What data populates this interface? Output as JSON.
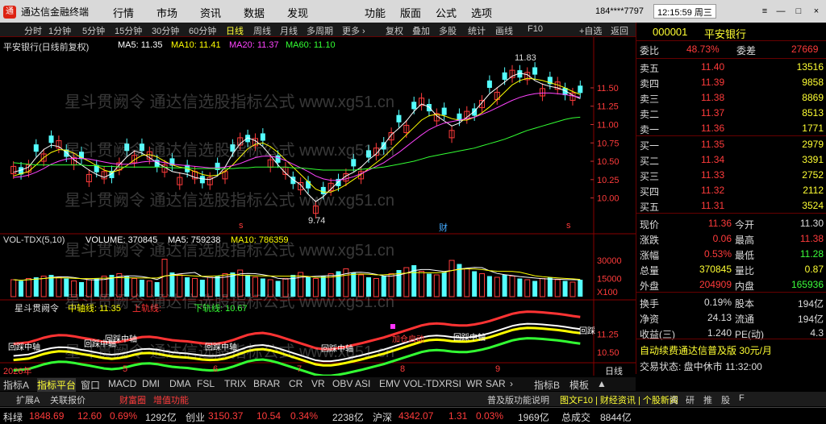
{
  "titlebar": {
    "app_name": "通达信金融终端",
    "menus": [
      "行情",
      "市场",
      "资讯",
      "数据",
      "发现",
      "功能",
      "版面",
      "公式",
      "选项"
    ],
    "account": "184****7797",
    "clock": "12:15:59 周三",
    "controls": [
      "≡",
      "—",
      "□",
      "×"
    ]
  },
  "toolbar": {
    "items": [
      "分时",
      "1分钟",
      "5分钟",
      "15分钟",
      "30分钟",
      "60分钟",
      "日线",
      "周线",
      "月线",
      "多周期",
      "更多 ›",
      "复权",
      "叠加",
      "多股",
      "统计",
      "画线",
      "F10",
      "+自选",
      "返回"
    ],
    "active": "日线"
  },
  "chart": {
    "main_label": "平安银行(日线前复权)",
    "ma_labels": [
      {
        "text": "MA5: 11.35",
        "color": "#ffffff"
      },
      {
        "text": "MA10: 11.41",
        "color": "#ffff00"
      },
      {
        "text": "MA20: 11.37",
        "color": "#ff44ff"
      },
      {
        "text": "MA60: 11.10",
        "color": "#33ff33"
      }
    ],
    "vol_label": "VOL-TDX(5,10)",
    "vol_values": [
      {
        "text": "VOLUME: 370845",
        "color": "#ffffff"
      },
      {
        "text": "MA5: 759238",
        "color": "#ffffff"
      },
      {
        "text": "MA10: 786359",
        "color": "#ffff00"
      }
    ],
    "ind_label": "星斗贯阙令",
    "ind_values": [
      {
        "text": "中轴线: 11.35",
        "color": "#ffff00"
      },
      {
        "text": "上轨线:",
        "color": "#ff3333"
      },
      {
        "text": "下轨线: 10.67",
        "color": "#33ff33"
      }
    ],
    "high_marker": "11.83",
    "low_marker": "9.74",
    "markers": [
      "s",
      "财",
      "s"
    ],
    "ind_tags": [
      "回踩中轴",
      "回踩中轴",
      "回踩中轴",
      "回踩中轴",
      "回踩中轴",
      "回踩中轴",
      "回踩"
    ],
    "start_tag": "加仓启动",
    "date_ticks": [
      "2026年",
      "5",
      "6",
      "7",
      "8",
      "9"
    ],
    "period_label": "日线",
    "watermark": "星斗贯阙令  通达信选股指标公式  www.xg51.cn"
  },
  "chart_data": [
    {
      "type": "line",
      "title": "",
      "ylim": [
        9.6,
        11.95
      ],
      "y_ticks": [
        "11.50",
        "11.25",
        "11.00",
        "10.75",
        "10.50",
        "10.25",
        "10.00"
      ],
      "series": [
        {
          "name": "MA5",
          "color": "#ffffff",
          "values": [
            10.35,
            10.38,
            10.42,
            10.55,
            10.66,
            10.72,
            10.7,
            10.62,
            10.52,
            10.45,
            10.38,
            10.32,
            10.28,
            10.33,
            10.45,
            10.56,
            10.64,
            10.61,
            10.55,
            10.48,
            10.42,
            10.36,
            10.34,
            10.32,
            10.28,
            10.26,
            10.25,
            10.3,
            10.42,
            10.6,
            10.74,
            10.82,
            10.78,
            10.7,
            10.58,
            10.45,
            10.34,
            10.25,
            10.18,
            10.05,
            9.95,
            10.02,
            10.12,
            10.22,
            10.3,
            10.35,
            10.42,
            10.52,
            10.6,
            10.72,
            10.86,
            10.95,
            11.05,
            11.18,
            11.28,
            11.24,
            11.12,
            11.05,
            10.98,
            11.02,
            11.1,
            11.18,
            11.3,
            11.42,
            11.5,
            11.58,
            11.66,
            11.7,
            11.68,
            11.6,
            11.55,
            11.52,
            11.5,
            11.46,
            11.4,
            11.35
          ]
        },
        {
          "name": "MA10",
          "color": "#ffff00",
          "values": [
            10.3,
            10.33,
            10.36,
            10.45,
            10.55,
            10.62,
            10.66,
            10.65,
            10.61,
            10.55,
            10.5,
            10.44,
            10.38,
            10.35,
            10.38,
            10.44,
            10.52,
            10.58,
            10.59,
            10.56,
            10.5,
            10.45,
            10.42,
            10.4,
            10.36,
            10.32,
            10.3,
            10.31,
            10.36,
            10.45,
            10.56,
            10.67,
            10.73,
            10.75,
            10.7,
            10.62,
            10.52,
            10.42,
            10.32,
            10.22,
            10.12,
            10.08,
            10.08,
            10.12,
            10.18,
            10.25,
            10.32,
            10.4,
            10.48,
            10.56,
            10.66,
            10.76,
            10.86,
            10.96,
            11.06,
            11.12,
            11.14,
            11.12,
            11.08,
            11.06,
            11.06,
            11.1,
            11.16,
            11.24,
            11.34,
            11.44,
            11.54,
            11.6,
            11.63,
            11.62,
            11.6,
            11.57,
            11.54,
            11.5,
            11.45,
            11.41
          ]
        },
        {
          "name": "MA20",
          "color": "#ff44ff",
          "values": [
            10.28,
            10.29,
            10.31,
            10.35,
            10.4,
            10.46,
            10.5,
            10.53,
            10.54,
            10.54,
            10.53,
            10.51,
            10.49,
            10.47,
            10.46,
            10.46,
            10.47,
            10.49,
            10.5,
            10.5,
            10.48,
            10.46,
            10.45,
            10.44,
            10.43,
            10.42,
            10.41,
            10.41,
            10.42,
            10.44,
            10.47,
            10.51,
            10.55,
            10.57,
            10.57,
            10.55,
            10.51,
            10.46,
            10.41,
            10.36,
            10.3,
            10.26,
            10.24,
            10.24,
            10.26,
            10.29,
            10.33,
            10.38,
            10.43,
            10.48,
            10.55,
            10.62,
            10.7,
            10.78,
            10.86,
            10.93,
            10.98,
            11.02,
            11.04,
            11.06,
            11.08,
            11.1,
            11.14,
            11.18,
            11.23,
            11.28,
            11.33,
            11.37,
            11.4,
            11.42,
            11.43,
            11.43,
            11.42,
            11.41,
            11.39,
            11.37
          ]
        },
        {
          "name": "MA60",
          "color": "#33ff33",
          "values": [
            10.48,
            10.47,
            10.46,
            10.45,
            10.45,
            10.45,
            10.45,
            10.45,
            10.45,
            10.45,
            10.44,
            10.44,
            10.43,
            10.43,
            10.42,
            10.42,
            10.42,
            10.42,
            10.42,
            10.42,
            10.42,
            10.41,
            10.41,
            10.41,
            10.4,
            10.4,
            10.4,
            10.4,
            10.4,
            10.4,
            10.41,
            10.41,
            10.42,
            10.42,
            10.42,
            10.42,
            10.42,
            10.41,
            10.41,
            10.4,
            10.39,
            10.38,
            10.38,
            10.38,
            10.38,
            10.38,
            10.39,
            10.4,
            10.41,
            10.42,
            10.44,
            10.46,
            10.48,
            10.5,
            10.53,
            10.56,
            10.58,
            10.6,
            10.62,
            10.64,
            10.66,
            10.68,
            10.71,
            10.74,
            10.77,
            10.8,
            10.84,
            10.88,
            10.92,
            10.95,
            10.98,
            11.01,
            11.04,
            11.07,
            11.09,
            11.1
          ]
        }
      ]
    },
    {
      "type": "bar",
      "title": "",
      "ylim": [
        0,
        40000
      ],
      "y_ticks": [
        "30000",
        "15000",
        "X100"
      ],
      "values": [
        14,
        13,
        15,
        16,
        17,
        18,
        16,
        15,
        13,
        12,
        14,
        15,
        17,
        18,
        19,
        17,
        15,
        14,
        13,
        12,
        31,
        20,
        18,
        16,
        15,
        14,
        16,
        17,
        19,
        20,
        22,
        18,
        16,
        15,
        14,
        13,
        15,
        18,
        20,
        16,
        15,
        17,
        19,
        21,
        23,
        20,
        18,
        16,
        15,
        17,
        19,
        22,
        24,
        26,
        21,
        19,
        18,
        20,
        30,
        27,
        23,
        21,
        19,
        17,
        16,
        18,
        17,
        15,
        14,
        13,
        15,
        16,
        14,
        13,
        12,
        14
      ]
    }
  ],
  "quote": {
    "code": "000001",
    "name": "平安银行",
    "weibi_label": "委比",
    "weibi_value": "48.73%",
    "weicha_label": "委差",
    "weicha_value": "27669",
    "asks": [
      {
        "label": "卖五",
        "price": "11.40",
        "vol": "13516"
      },
      {
        "label": "卖四",
        "price": "11.39",
        "vol": "9858"
      },
      {
        "label": "卖三",
        "price": "11.38",
        "vol": "8869"
      },
      {
        "label": "卖二",
        "price": "11.37",
        "vol": "8513"
      },
      {
        "label": "卖一",
        "price": "11.36",
        "vol": "1771"
      }
    ],
    "bids": [
      {
        "label": "买一",
        "price": "11.35",
        "vol": "2979"
      },
      {
        "label": "买二",
        "price": "11.34",
        "vol": "3391"
      },
      {
        "label": "买三",
        "price": "11.33",
        "vol": "2752"
      },
      {
        "label": "买四",
        "price": "11.32",
        "vol": "2112"
      },
      {
        "label": "买五",
        "price": "11.31",
        "vol": "3524"
      }
    ],
    "stats": [
      {
        "l1": "现价",
        "v1": "11.36",
        "c1": "red",
        "l2": "今开",
        "v2": "11.30",
        "c2": "wht"
      },
      {
        "l1": "涨跌",
        "v1": "0.06",
        "c1": "red",
        "l2": "最高",
        "v2": "11.38",
        "c2": "red"
      },
      {
        "l1": "涨幅",
        "v1": "0.53%",
        "c1": "red",
        "l2": "最低",
        "v2": "11.28",
        "c2": "grn"
      },
      {
        "l1": "总量",
        "v1": "370845",
        "c1": "yel",
        "l2": "量比",
        "v2": "0.87",
        "c2": "yel"
      },
      {
        "l1": "外盘",
        "v1": "204909",
        "c1": "red",
        "l2": "内盘",
        "v2": "165936",
        "c2": "grn"
      }
    ],
    "stats2": [
      {
        "l1": "换手",
        "v1": "0.19%",
        "l2": "股本",
        "v2": "194亿"
      },
      {
        "l1": "净资",
        "v1": "24.13",
        "l2": "流通",
        "v2": "194亿"
      },
      {
        "l1": "收益(三)",
        "v1": "1.240",
        "l2": "PE(动)",
        "v2": "4.3"
      }
    ],
    "promo": "自动续费通达信普及版 30元/月",
    "trade_state": "交易状态: 盘中休市 11:32:00"
  },
  "tabs1": {
    "items": [
      "指标A",
      "指标平台",
      "窗口",
      "MACD",
      "DMI",
      "DMA",
      "FSL",
      "TRIX",
      "BRAR",
      "CR",
      "VR",
      "OBV",
      "ASI",
      "EMV",
      "VOL-TDX",
      "RSI",
      "WR",
      "SAR",
      "›",
      "指标B",
      "模板",
      "▲"
    ],
    "active": "指标平台"
  },
  "tabs2": {
    "items": [
      "扩展A",
      "关联报价",
      "财富圈",
      "增值功能",
      "普及版功能说明",
      "图文F10 | 财经资讯 | 个股新闻",
      "资",
      "研",
      "推",
      "股",
      "F"
    ]
  },
  "status": {
    "items": [
      {
        "text": "科绿",
        "c": "wht"
      },
      {
        "text": "1848.69",
        "c": "red"
      },
      {
        "text": "12.60",
        "c": "red"
      },
      {
        "text": "0.69%",
        "c": "red"
      },
      {
        "text": "1292亿",
        "c": "wht"
      },
      {
        "text": "创业",
        "c": "wht"
      },
      {
        "text": "3150.37",
        "c": "red"
      },
      {
        "text": "10.54",
        "c": "red"
      },
      {
        "text": "0.34%",
        "c": "red"
      },
      {
        "text": "2238亿",
        "c": "wht"
      },
      {
        "text": "沪深",
        "c": "wht"
      },
      {
        "text": "4342.07",
        "c": "red"
      },
      {
        "text": "1.31",
        "c": "red"
      },
      {
        "text": "0.03%",
        "c": "red"
      },
      {
        "text": "1969亿",
        "c": "wht"
      },
      {
        "text": "总成交",
        "c": "wht"
      },
      {
        "text": "8844亿",
        "c": "wht"
      }
    ]
  }
}
